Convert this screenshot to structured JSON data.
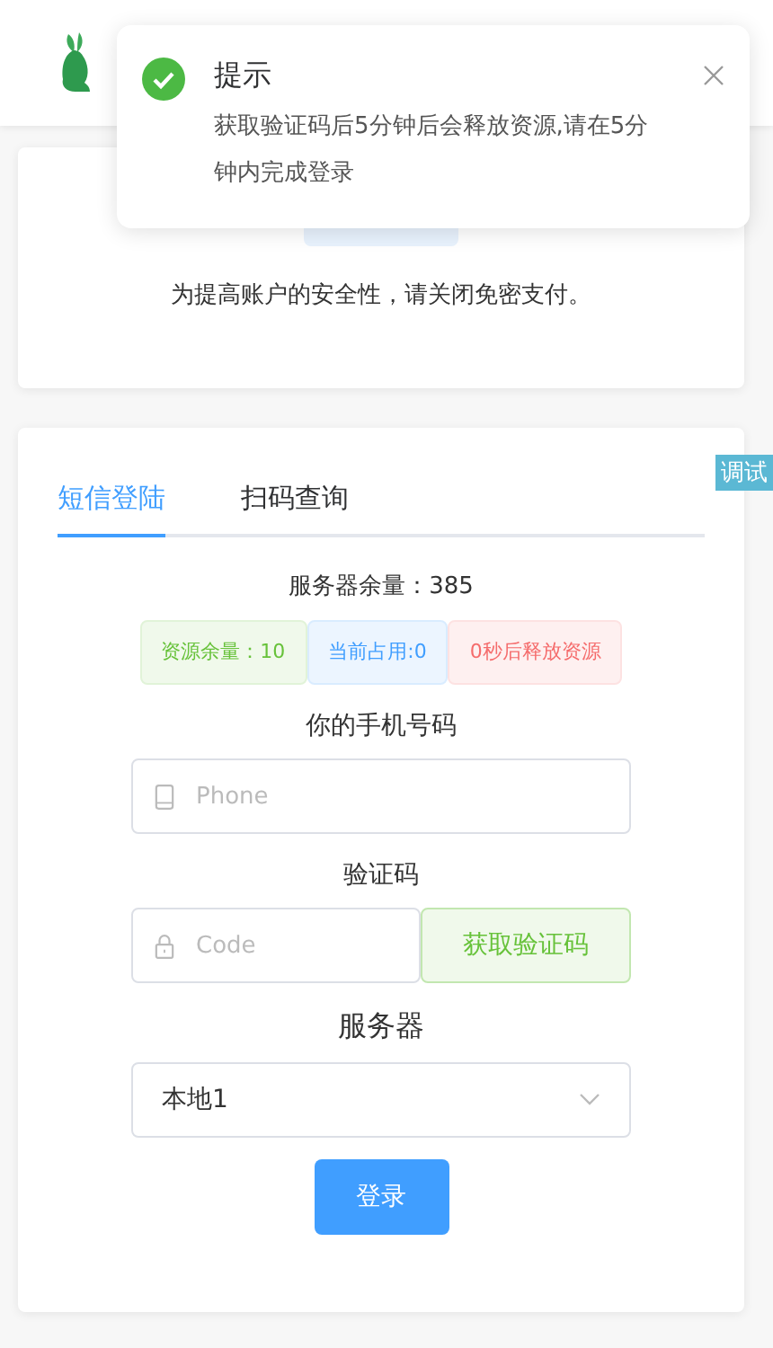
{
  "notification": {
    "kind": "success",
    "title": "提示",
    "message": "获取验证码后5分钟后会释放资源,请在5分钟内完成登录"
  },
  "notice_card": {
    "text": "为提高账户的安全性，请关闭免密支付。"
  },
  "debug_badge": "调试",
  "login": {
    "tabs": [
      {
        "label": "短信登陆",
        "selected": true
      },
      {
        "label": "扫码查询",
        "selected": false
      }
    ],
    "server_remaining": "服务器余量：385",
    "tags": [
      {
        "kind": "success",
        "text": "资源余量：10"
      },
      {
        "kind": "primary",
        "text": "当前占用:0"
      },
      {
        "kind": "danger",
        "text": "0秒后释放资源"
      }
    ],
    "phone_label": "你的手机号码",
    "phone_placeholder": "Phone",
    "code_label": "验证码",
    "code_placeholder": "Code",
    "code_button": "获取验证码",
    "server_label": "服务器",
    "server_value": "本地1",
    "submit": "登录"
  }
}
